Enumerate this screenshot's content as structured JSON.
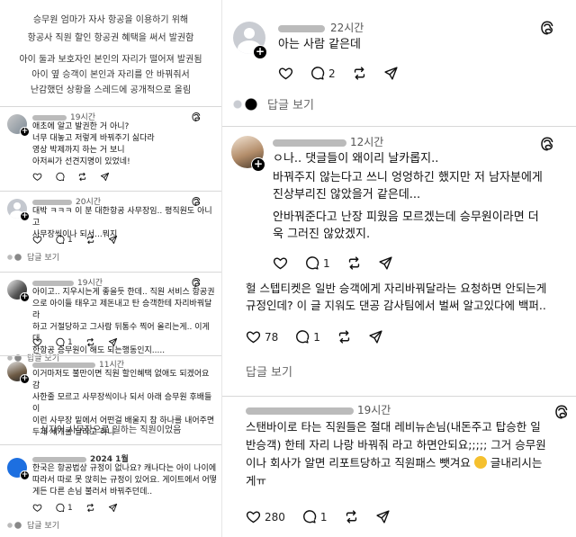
{
  "left": {
    "captions": {
      "top": [
        "승무원 엄마가 자사 항공을 이용하기 위해",
        "항공사 직원 할인 항공권 혜택을 써서 발권함"
      ],
      "mid": [
        "아이 둘과 보호자인 본인의 자리가 떨어져 발권됨",
        "아이 옆 승객이 본인과 자리를 안 바꿔줘서",
        "난감했던 상황을 스레드에 공개적으로 올림"
      ],
      "note": "심지어 사무장으로 일하는 직원이었음"
    },
    "posts": [
      {
        "time": "19시간",
        "lines": [
          "애초에 알고 발권한 거 아니?",
          "너무 대놓고 저렇게 바꿔주기 싫다라",
          "영상 박제까지 하는 거 보니",
          "아저씨가 선견지명이 있었네!"
        ],
        "likes": "",
        "replies": ""
      },
      {
        "time": "20시간",
        "lines": [
          "대박 ㅋㅋㅋ 이 분 대한항공 사무장임.. 평직원도 아니고",
          "사무장씩이나 되서...뭐지"
        ],
        "likes": "",
        "replies": "1",
        "reply_link": "답글 보기"
      },
      {
        "time": "19시간",
        "lines": [
          "아이고.. 지우시는게 좋을듯 한데.. 직원 서비스 항공권",
          "으로 아이들 태우고 제돈내고 탄 승객한테 자리바꿔달라",
          "하고 거절당하고 그사람 뒤통수 찍어 올리는게.. 이게 대",
          "한항공 승무원이 해도 되는행동인지....."
        ],
        "likes": "",
        "replies": "1",
        "reply_link": "답글 보기"
      },
      {
        "time": "11시간",
        "lines": [
          "이거마저도 불만이면 직원 할인혜택 없애도 되겠어요 감",
          "사한줄 모르고 사무장씩이나 되서 아래 승무원 후배들이",
          "이런 사무장 밑에서 어떤걸 배울지 참 하나를 내어주면",
          "두개 세개를 달라고 하니"
        ],
        "likes": "",
        "replies": ""
      },
      {
        "time": "2024 1월",
        "lines": [
          "한국은 항공법상 규정이 없나요? 캐나다는 아이 나이에",
          "따라서 따로 못 앉히는 규정이 있어요. 게이트에서 어떻",
          "게든 다른 손님 불러서 바꿔주던데.."
        ],
        "likes": "",
        "replies": "1",
        "reply_link": "답글 보기"
      }
    ]
  },
  "right": {
    "posts": [
      {
        "time": "22시간",
        "lines": [
          "아는 사람 같은데"
        ],
        "likes": "",
        "replies": "2",
        "reply_link": "답글 보기"
      },
      {
        "time": "12시간",
        "lines": [
          "ㅇ나.. 댓글들이 왜이리 날카롭지..",
          "바꿔주지 않는다고 쓰니 엉엉하긴 했지만 저 남자분에게",
          "진상부리진 않았을거 같은데...",
          "안바꿔준다고 난장 피웠음 모르겠는데 승무원이라면 더",
          "욱 그러진 않았겠지."
        ],
        "likes": "",
        "replies": "1"
      },
      {
        "time": "",
        "lines": [
          "헐 스텝티켓은 일반 승객에게 자리바꿔달라는 요청하면 안되는게",
          "규정인데? 이 글 지워도 댄공 감사팀에서 벌써 알고있다에 백퍼.."
        ],
        "likes": "78",
        "replies": "1",
        "reply_link": "답글 보기"
      },
      {
        "time": "19시간",
        "lines": [
          "스탠바이로 타는 직원들은 절대 레비뉴손님(내돈주고 탑승한 일",
          "반승객) 한테 자리 나랑 바꿔줘 라고 하면안되요;;;;; 그거 승무원",
          "이나 회사가 알면 리포트당하고 직원패스 뺏겨요",
          "게ㅠ"
        ],
        "emoji_tail": "글내리시는",
        "likes": "280",
        "replies": "1"
      }
    ]
  },
  "icons": [
    "heart-icon",
    "comment-icon",
    "repost-icon",
    "share-icon",
    "threads-logo-icon",
    "plus-badge-icon",
    "reply-indicator-icon"
  ]
}
